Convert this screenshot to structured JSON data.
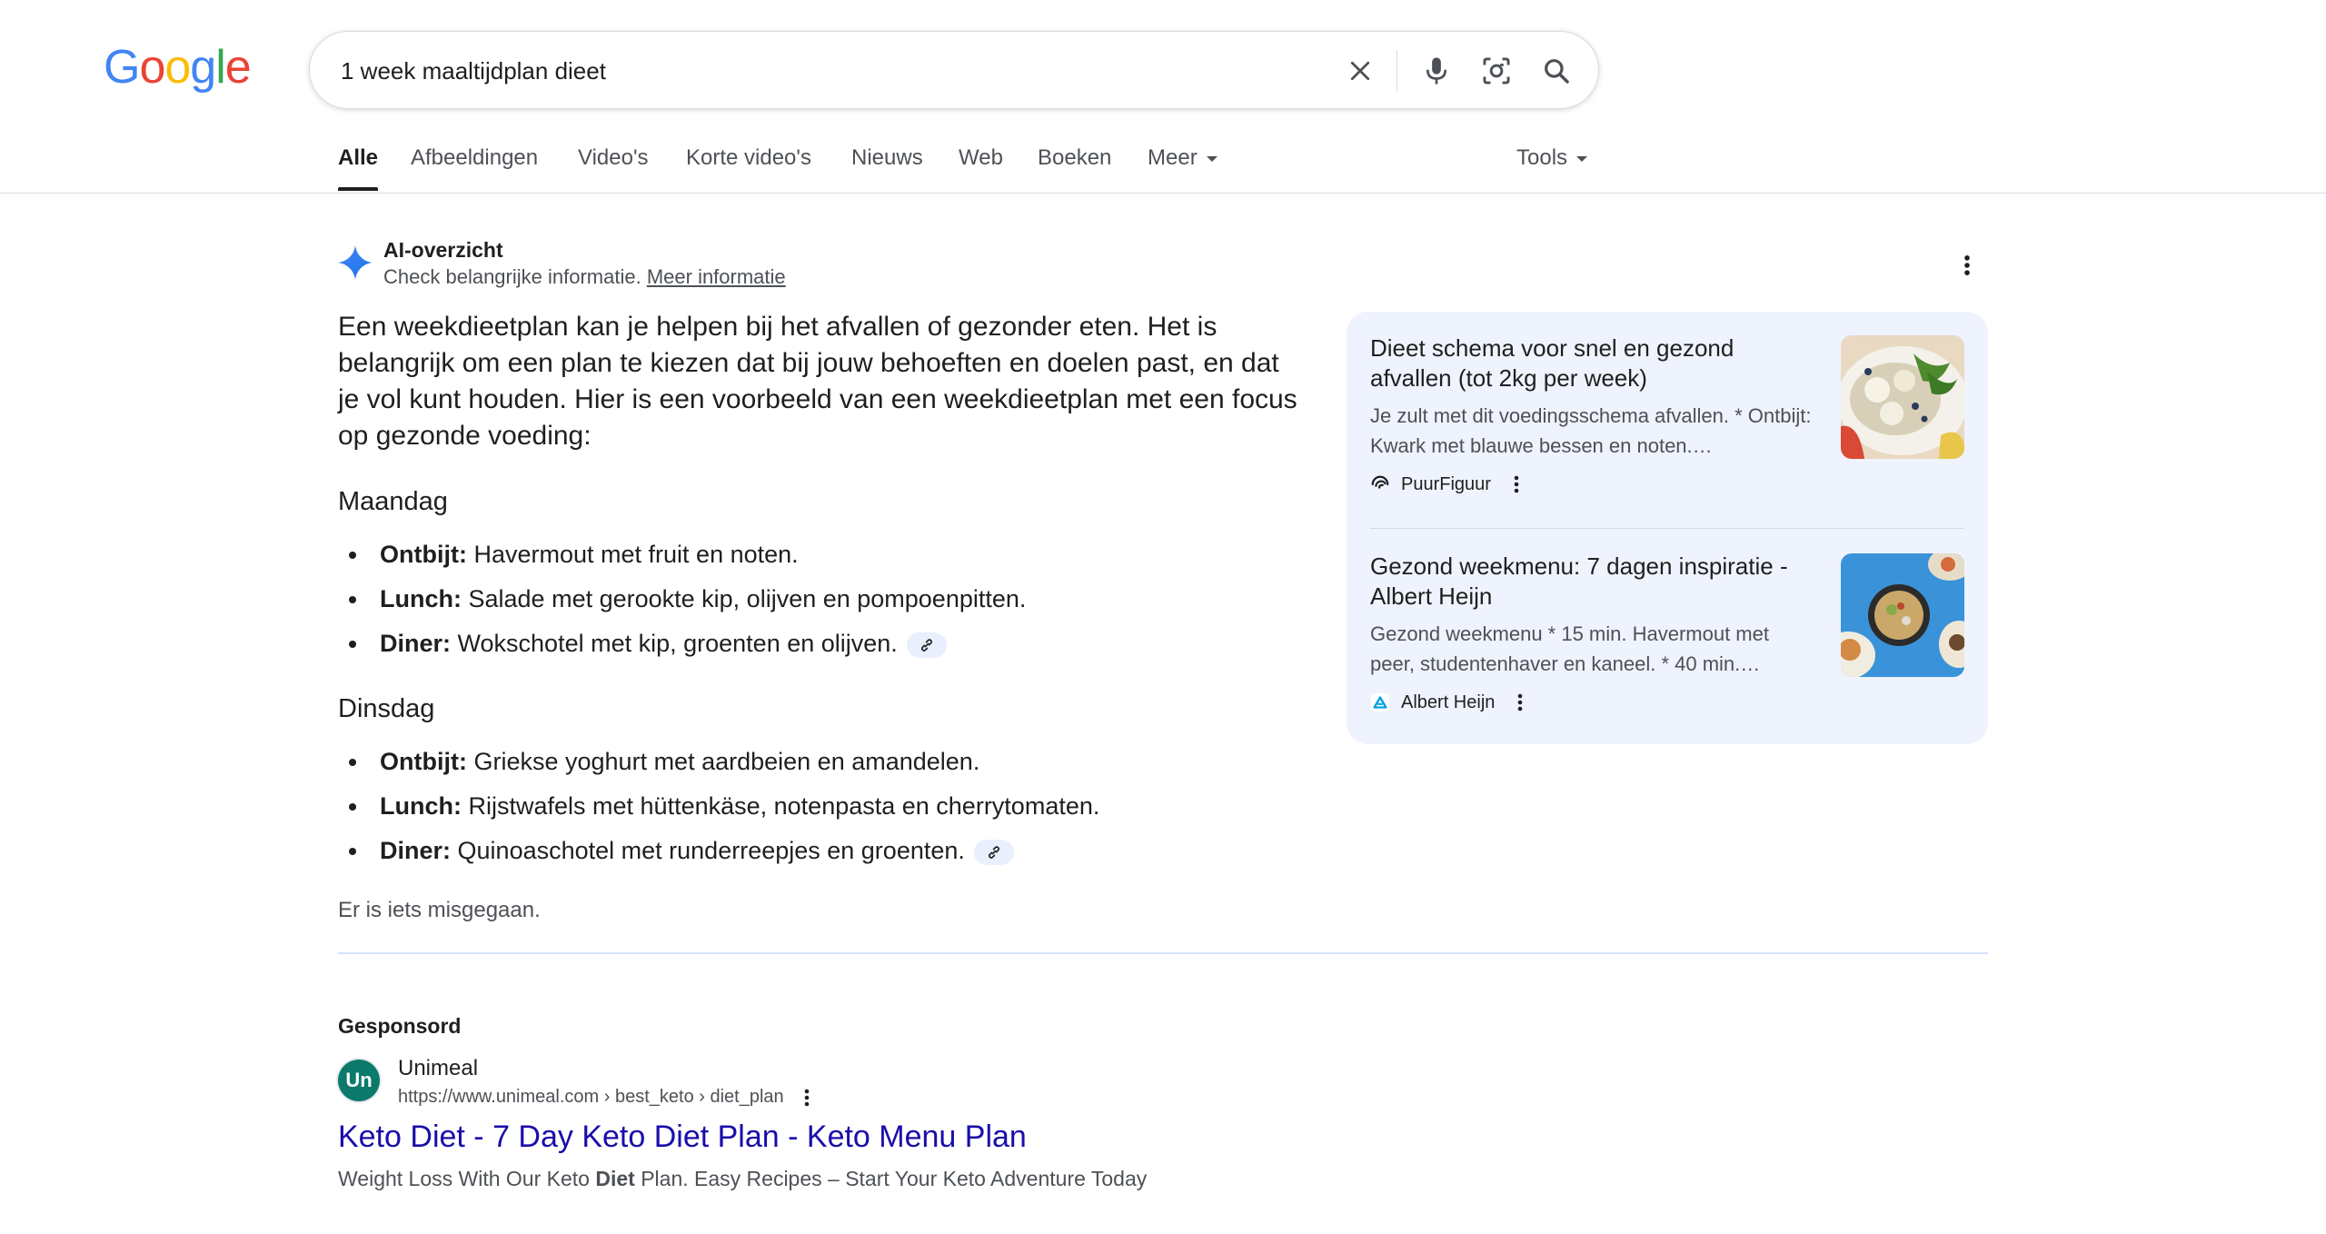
{
  "logo": {
    "letters": [
      "G",
      "o",
      "o",
      "g",
      "l",
      "e"
    ],
    "colors": [
      "#4285f4",
      "#ea4335",
      "#fbbc05",
      "#4285f4",
      "#34a853",
      "#ea4335"
    ]
  },
  "search": {
    "query": "1 week maaltijdplan dieet"
  },
  "tabs": [
    {
      "label": "Alle"
    },
    {
      "label": "Afbeeldingen"
    },
    {
      "label": "Video's"
    },
    {
      "label": "Korte video's"
    },
    {
      "label": "Nieuws"
    },
    {
      "label": "Web"
    },
    {
      "label": "Boeken"
    },
    {
      "label": "Meer"
    }
  ],
  "tools_label": "Tools",
  "ai_overview": {
    "title": "AI-overzicht",
    "subtitle": "Check belangrijke informatie.",
    "more_info": "Meer informatie",
    "intro": "Een weekdieetplan kan je helpen bij het afvallen of gezonder eten. Het is belangrijk om een plan te kiezen dat bij jouw behoeften en doelen past, en dat je vol kunt houden. Hier is een voorbeeld van een weekdieetplan met een focus op gezonde voeding:",
    "days": [
      {
        "name": "Maandag",
        "meals": [
          {
            "label": "Ontbijt:",
            "text": "Havermout met fruit en noten."
          },
          {
            "label": "Lunch:",
            "text": "Salade met gerookte kip, olijven en pompoenpitten."
          },
          {
            "label": "Diner:",
            "text": "Wokschotel met kip, groenten en olijven."
          }
        ]
      },
      {
        "name": "Dinsdag",
        "meals": [
          {
            "label": "Ontbijt:",
            "text": "Griekse yoghurt met aardbeien en amandelen."
          },
          {
            "label": "Lunch:",
            "text": "Rijstwafels met hüttenkäse, notenpasta en cherrytomaten."
          },
          {
            "label": "Diner:",
            "text": "Quinoaschotel met runderreepjes en groenten."
          }
        ]
      }
    ],
    "error": "Er is iets misgegaan."
  },
  "sources": [
    {
      "title": "Dieet schema voor snel en gezond afvallen (tot 2kg per week)",
      "snippet": "Je zult met dit voedingsschema afvallen. * Ontbijt: Kwark met blauwe bessen en noten.…",
      "site": "PuurFiguur",
      "favicon_icon": "puurfiguur-swirl-icon"
    },
    {
      "title": "Gezond weekmenu: 7 dagen inspiratie - Albert Heijn",
      "snippet": "Gezond weekmenu * 15 min. Havermout met peer, studentenhaver en kaneel. * 40 min.…",
      "site": "Albert Heijn",
      "favicon_icon": "albert-heijn-icon"
    }
  ],
  "ad": {
    "label": "Gesponsord",
    "advertiser": "Unimeal",
    "favicon_text": "Un",
    "url": "https://www.unimeal.com › best_keto › diet_plan",
    "title": "Keto Diet - 7 Day Keto Diet Plan - Keto Menu Plan",
    "desc_before": "Weight Loss With Our Keto ",
    "desc_bold": "Diet",
    "desc_after": " Plan. Easy Recipes – Start Your Keto Adventure Today"
  },
  "colors": {
    "link": "#1a0dab",
    "panel_bg": "#eef3fd",
    "text": "#1f1f1f",
    "secondary": "#4d5156"
  }
}
